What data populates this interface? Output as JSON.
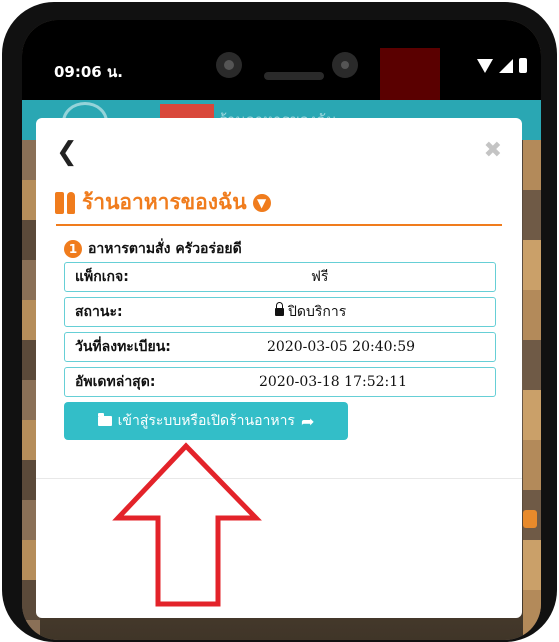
{
  "status_bar": {
    "time": "09:06 น."
  },
  "app_header": {
    "title": "ร้านอาหารของฉัน"
  },
  "modal": {
    "title": "ร้านอาหารของฉัน",
    "restaurant_index": "1",
    "restaurant_name": "อาหารตามสั่ง ครัวอร่อยดี",
    "rows": [
      {
        "label": "แพ็กเกจ:",
        "value": "ฟรี"
      },
      {
        "label": "สถานะ:",
        "value": "ปิดบริการ"
      },
      {
        "label": "วันที่ลงทะเบียน:",
        "value": "2020-03-05 20:40:59"
      },
      {
        "label": "อัพเดทล่าสุด:",
        "value": "2020-03-18 17:52:11"
      }
    ],
    "cta_label": "เข้าสู่ระบบหรือเปิดร้านอาหาร"
  },
  "icons": {
    "back": "chevron-left-icon",
    "close": "close-icon",
    "title_icon": "utensils-icon",
    "title_dropdown": "circle-down-icon",
    "status_lock": "lock-icon",
    "cta_left": "folder-open-icon",
    "cta_right": "share-arrow-icon"
  },
  "colors": {
    "accent_orange": "#f07c1d",
    "teal": "#33bec8",
    "row_border": "#66cfd6",
    "annotation_arrow": "#e3232a"
  }
}
